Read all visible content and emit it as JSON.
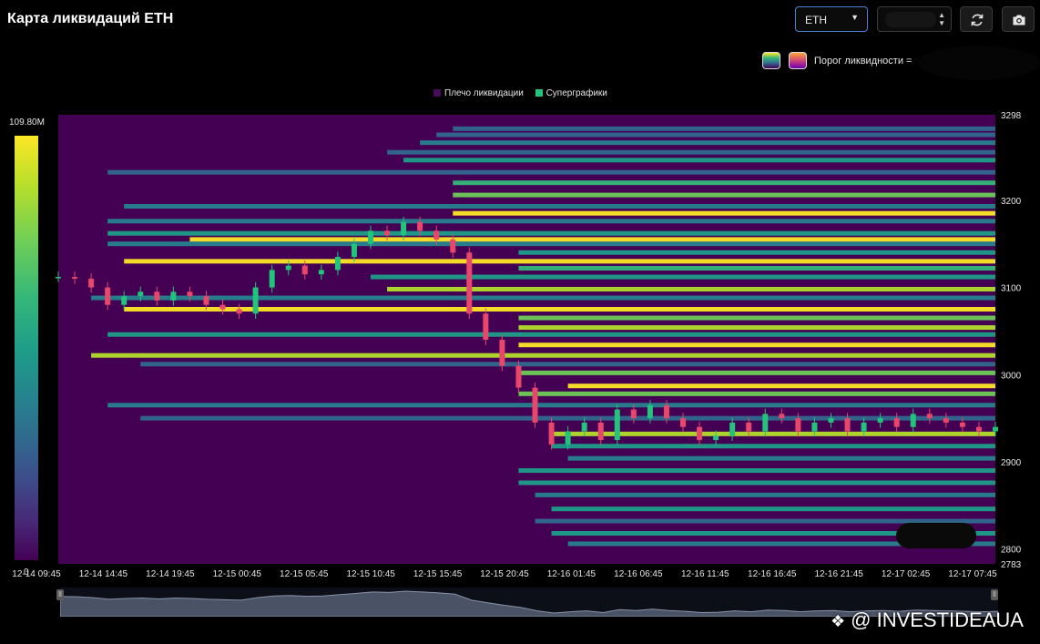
{
  "header": {
    "title": "Карта ликвидаций ETH"
  },
  "toolbar": {
    "symbol_select": {
      "value": "ETH"
    },
    "refresh_icon": "refresh-icon",
    "camera_icon": "camera-icon"
  },
  "controls": {
    "palette_options": [
      "viridis",
      "magma"
    ],
    "threshold_label": "Порог ликвидности ="
  },
  "legend": [
    {
      "label": "Плечо ликвидации",
      "color": "#4a0a5a"
    },
    {
      "label": "Суперграфики",
      "color": "#22c37a"
    }
  ],
  "colorbar": {
    "max_label": "109.80M",
    "min_label": "0"
  },
  "watermark": {
    "text": "@ INVESTIDEAUA"
  },
  "colors": {
    "background": "#440154",
    "candle_up": "#22c37a",
    "candle_down": "#e8466a",
    "highlight": "#fde725"
  },
  "chart_data": {
    "type": "heatmap",
    "x_tick_labels": [
      "12-14 09:45",
      "12-14 14:45",
      "12-14 19:45",
      "12-15 00:45",
      "12-15 05:45",
      "12-15 10:45",
      "12-15 15:45",
      "12-15 20:45",
      "12-16 01:45",
      "12-16 06:45",
      "12-16 11:45",
      "12-16 16:45",
      "12-16 21:45",
      "12-17 02:45",
      "12-17 07:45"
    ],
    "y_ticks": [
      2800,
      2900,
      3000,
      3100,
      3200
    ],
    "y_range": [
      2783,
      3298
    ],
    "y_top_label": "3298",
    "y_bottom_label": "2783",
    "price_path": [
      [
        0,
        3112
      ],
      [
        1,
        3110
      ],
      [
        2,
        3100
      ],
      [
        3,
        3080
      ],
      [
        4,
        3090
      ],
      [
        5,
        3095
      ],
      [
        6,
        3085
      ],
      [
        7,
        3095
      ],
      [
        8,
        3090
      ],
      [
        9,
        3080
      ],
      [
        10,
        3075
      ],
      [
        11,
        3070
      ],
      [
        12,
        3100
      ],
      [
        13,
        3120
      ],
      [
        14,
        3125
      ],
      [
        15,
        3115
      ],
      [
        16,
        3120
      ],
      [
        17,
        3135
      ],
      [
        18,
        3150
      ],
      [
        19,
        3165
      ],
      [
        20,
        3160
      ],
      [
        21,
        3175
      ],
      [
        22,
        3165
      ],
      [
        23,
        3155
      ],
      [
        24,
        3140
      ],
      [
        25,
        3070
      ],
      [
        26,
        3040
      ],
      [
        27,
        3010
      ],
      [
        28,
        2985
      ],
      [
        29,
        2945
      ],
      [
        30,
        2920
      ],
      [
        31,
        2935
      ],
      [
        32,
        2945
      ],
      [
        33,
        2925
      ],
      [
        34,
        2960
      ],
      [
        35,
        2950
      ],
      [
        36,
        2965
      ],
      [
        37,
        2950
      ],
      [
        38,
        2940
      ],
      [
        39,
        2925
      ],
      [
        40,
        2930
      ],
      [
        41,
        2945
      ],
      [
        42,
        2935
      ],
      [
        43,
        2955
      ],
      [
        44,
        2950
      ],
      [
        45,
        2935
      ],
      [
        46,
        2945
      ],
      [
        47,
        2950
      ],
      [
        48,
        2935
      ],
      [
        49,
        2945
      ],
      [
        50,
        2950
      ],
      [
        51,
        2940
      ],
      [
        52,
        2955
      ],
      [
        53,
        2950
      ],
      [
        54,
        2945
      ],
      [
        55,
        2940
      ],
      [
        56,
        2935
      ],
      [
        57,
        2940
      ]
    ],
    "liquidation_bands": [
      {
        "price": 3282,
        "start": 24,
        "level": 0.35
      },
      {
        "price": 3275,
        "start": 23,
        "level": 0.3
      },
      {
        "price": 3266,
        "start": 22,
        "level": 0.4
      },
      {
        "price": 3255,
        "start": 20,
        "level": 0.35
      },
      {
        "price": 3246,
        "start": 21,
        "level": 0.5
      },
      {
        "price": 3232,
        "start": 3,
        "level": 0.3
      },
      {
        "price": 3220,
        "start": 24,
        "level": 0.7
      },
      {
        "price": 3206,
        "start": 24,
        "level": 0.8
      },
      {
        "price": 3193,
        "start": 4,
        "level": 0.4
      },
      {
        "price": 3185,
        "start": 24,
        "level": 1.0
      },
      {
        "price": 3176,
        "start": 3,
        "level": 0.45
      },
      {
        "price": 3162,
        "start": 3,
        "level": 0.6
      },
      {
        "price": 3155,
        "start": 8,
        "level": 0.95
      },
      {
        "price": 3150,
        "start": 3,
        "level": 0.4
      },
      {
        "price": 3140,
        "start": 28,
        "level": 0.5
      },
      {
        "price": 3130,
        "start": 4,
        "level": 0.95
      },
      {
        "price": 3122,
        "start": 28,
        "level": 0.7
      },
      {
        "price": 3112,
        "start": 19,
        "level": 0.5
      },
      {
        "price": 3098,
        "start": 20,
        "level": 0.9
      },
      {
        "price": 3088,
        "start": 2,
        "level": 0.45
      },
      {
        "price": 3075,
        "start": 4,
        "level": 1.0
      },
      {
        "price": 3065,
        "start": 28,
        "level": 0.75
      },
      {
        "price": 3054,
        "start": 28,
        "level": 0.85
      },
      {
        "price": 3046,
        "start": 3,
        "level": 0.6
      },
      {
        "price": 3034,
        "start": 28,
        "level": 1.0
      },
      {
        "price": 3022,
        "start": 2,
        "level": 0.85
      },
      {
        "price": 3012,
        "start": 5,
        "level": 0.3
      },
      {
        "price": 3002,
        "start": 28,
        "level": 0.75
      },
      {
        "price": 2987,
        "start": 31,
        "level": 1.0
      },
      {
        "price": 2978,
        "start": 28,
        "level": 0.8
      },
      {
        "price": 2965,
        "start": 3,
        "level": 0.45
      },
      {
        "price": 2950,
        "start": 5,
        "level": 0.35
      },
      {
        "price": 2932,
        "start": 30,
        "level": 0.85
      },
      {
        "price": 2918,
        "start": 30,
        "level": 0.6
      },
      {
        "price": 2904,
        "start": 31,
        "level": 0.45
      },
      {
        "price": 2890,
        "start": 28,
        "level": 0.55
      },
      {
        "price": 2876,
        "start": 28,
        "level": 0.5
      },
      {
        "price": 2862,
        "start": 29,
        "level": 0.4
      },
      {
        "price": 2846,
        "start": 30,
        "level": 0.6
      },
      {
        "price": 2832,
        "start": 29,
        "level": 0.35
      },
      {
        "price": 2818,
        "start": 30,
        "level": 0.5
      },
      {
        "price": 2806,
        "start": 31,
        "level": 0.4
      }
    ]
  }
}
